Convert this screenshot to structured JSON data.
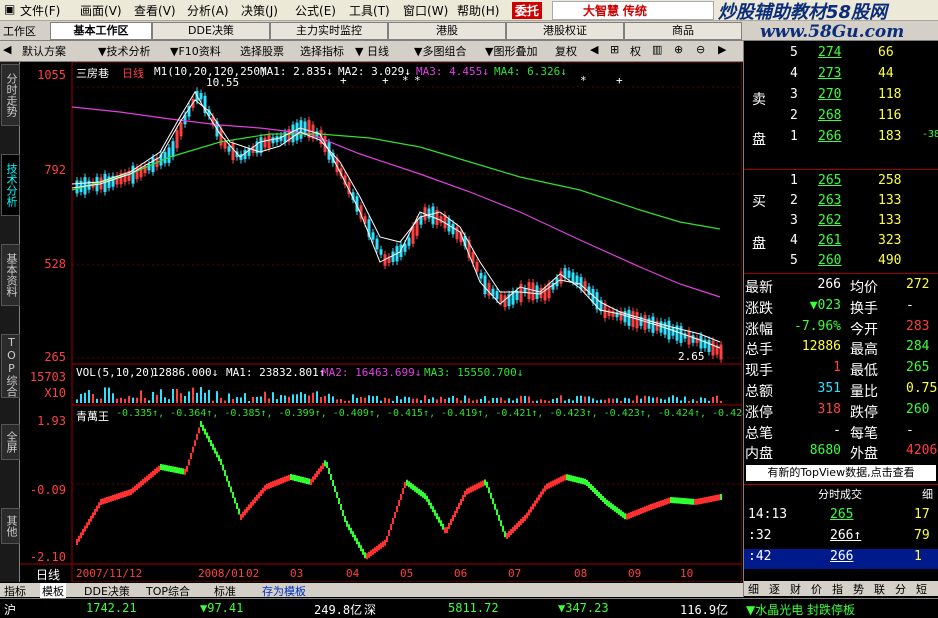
{
  "menu": {
    "items": [
      "文件",
      "画面",
      "查看",
      "分析",
      "决策",
      "公式",
      "工具",
      "窗口",
      "帮助"
    ],
    "trade_btn": "委托",
    "brand": "大智慧",
    "brand_sub": "传统",
    "watermark_title": "炒股辅助教材58股网",
    "watermark_url": "www.58Gu.com"
  },
  "workbar": {
    "label": "工作区",
    "tabs": [
      "基本工作区",
      "DDE决策",
      "主力实时监控",
      "港股",
      "港股权证",
      "商品"
    ]
  },
  "toolbar": {
    "items": [
      "默认方案",
      "技术分析",
      "F10资料",
      "选择股票",
      "选择指标",
      "日线",
      "多图组合",
      "图形叠加",
      "复权",
      "权",
      "",
      "",
      ""
    ]
  },
  "left_tabs": [
    "分时走势",
    "技术分析",
    "基本资料",
    "TOP综合",
    "全屏",
    "其他"
  ],
  "chart": {
    "stock_name": "三房巷",
    "period": "日线",
    "m1_label": "M1(10,20,120,250)",
    "ma1": "MA1: 2.835↓",
    "ma2": "MA2: 3.029↓",
    "ma3": "MA3: 4.455↓",
    "ma4": "MA4: 6.326↓",
    "high_label": "10.55",
    "low_label": "2.65",
    "price_ticks": [
      "1055",
      "792",
      "528",
      "265"
    ],
    "vol_header": "VOL(5,10,20)",
    "vol_val": "12886.000↓",
    "vol_ma1": "MA1: 23832.801↑",
    "vol_ma2": "MA2: 16463.699↓",
    "vol_ma3": "MA3: 15550.700↓",
    "vol_ticks": [
      "15703",
      "X10"
    ],
    "ind_name": "青萬王",
    "ind_vals": "-0.335↑, -0.364↑, -0.385↑, -0.399↑, -0.409↑, -0.415↑, -0.419↑, -0.421↑, -0.423↑, -0.423↑, -0.424↑, -0.424↑",
    "ind_ticks": [
      "1.93",
      "-0.09",
      "-2.10"
    ],
    "x_ticks": [
      "日线",
      "2007/11/12",
      "2008/01",
      "02",
      "03",
      "04",
      "05",
      "06",
      "07",
      "08",
      "09",
      "10"
    ]
  },
  "bottom_tabs": [
    "指标",
    "模板",
    "DDE决策",
    "TOP综合",
    "标准",
    "存为模板"
  ],
  "status": {
    "market": "沪",
    "idx1": "1742.21",
    "chg1": "▼97.41",
    "amt1": "249.8亿",
    "label2": "深",
    "idx2": "5811.72",
    "chg2": "▼347.23",
    "amt2": "116.9亿",
    "ticker": "▼水晶光电 封跌停板"
  },
  "rpanel": {
    "sell_label": [
      "卖",
      "盘"
    ],
    "buy_label": [
      "买",
      "盘"
    ],
    "sell": [
      {
        "lvl": "5",
        "price": "274",
        "vol": "66"
      },
      {
        "lvl": "4",
        "price": "273",
        "vol": "44"
      },
      {
        "lvl": "3",
        "price": "270",
        "vol": "118"
      },
      {
        "lvl": "2",
        "price": "268",
        "vol": "116"
      },
      {
        "lvl": "1",
        "price": "266",
        "vol": "183",
        "extra": "-38"
      }
    ],
    "buy": [
      {
        "lvl": "1",
        "price": "265",
        "vol": "258"
      },
      {
        "lvl": "2",
        "price": "263",
        "vol": "133"
      },
      {
        "lvl": "3",
        "price": "262",
        "vol": "133"
      },
      {
        "lvl": "4",
        "price": "261",
        "vol": "323"
      },
      {
        "lvl": "5",
        "price": "260",
        "vol": "490"
      }
    ],
    "quote": [
      {
        "k1": "最新",
        "v1": "266",
        "k2": "均价",
        "v2": "272"
      },
      {
        "k1": "涨跌",
        "v1": "▼023",
        "k2": "换手",
        "v2": "-"
      },
      {
        "k1": "涨幅",
        "v1": "-7.96%",
        "k2": "今开",
        "v2": "283"
      },
      {
        "k1": "总手",
        "v1": "12886",
        "k2": "最高",
        "v2": "284"
      },
      {
        "k1": "现手",
        "v1": "1",
        "k2": "最低",
        "v2": "265"
      },
      {
        "k1": "总额",
        "v1": "351",
        "k2": "量比",
        "v2": "0.75"
      },
      {
        "k1": "涨停",
        "v1": "318",
        "k2": "跌停",
        "v2": "260"
      },
      {
        "k1": "总笔",
        "v1": "-",
        "k2": "每笔",
        "v2": "-"
      },
      {
        "k1": "内盘",
        "v1": "8680",
        "k2": "外盘",
        "v2": "4206"
      }
    ],
    "topview": "有新的TopView数据,点击查看",
    "deals_title": "分时成交",
    "deals_more": "细",
    "deals": [
      {
        "time": "14:13",
        "price": "265",
        "vol": "17"
      },
      {
        "time": ":32",
        "price": "266↑",
        "vol": "79"
      },
      {
        "time": ":42",
        "price": "266",
        "vol": "1"
      }
    ],
    "bottom_tabs": [
      "细",
      "逐",
      "财",
      "价",
      "指",
      "势",
      "联",
      "分",
      "短"
    ]
  }
}
